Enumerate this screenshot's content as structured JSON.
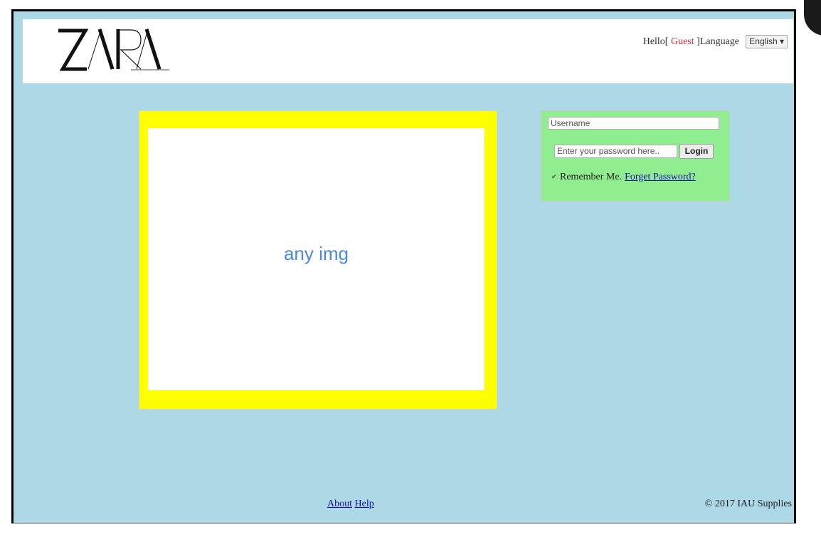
{
  "header": {
    "logo_text": "ZARA",
    "hello_prefix": "Hello[",
    "user_name": " Guest ",
    "hello_suffix": "]Language",
    "language": "English ▾"
  },
  "image_placeholder": {
    "text": "any img"
  },
  "login": {
    "username_placeholder": "Username",
    "password_placeholder": "Enter your password here..",
    "login_label": "Login",
    "remember_label": "Remember Me.",
    "forget_label": "Forget Password?"
  },
  "footer": {
    "about_label": "About",
    "help_label": "Help",
    "copyright": "© 2017 IAU Supplies"
  },
  "colors": {
    "background": "#add8e6",
    "image_border": "#ffff00",
    "login_panel": "#90ee90",
    "link": "#1a0dab",
    "guest": "#dd3333"
  }
}
